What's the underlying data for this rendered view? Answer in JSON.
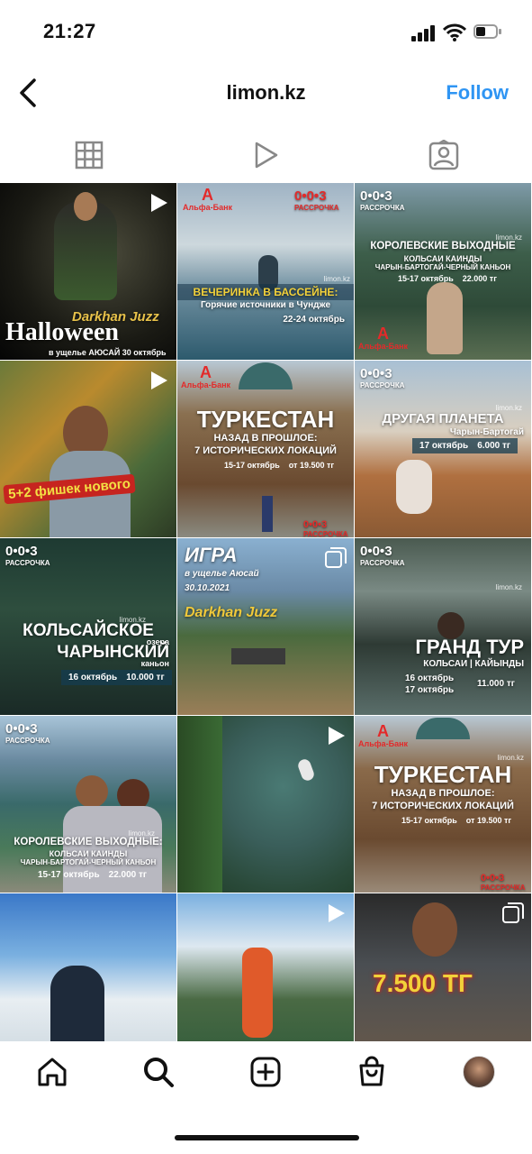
{
  "status": {
    "time": "21:27"
  },
  "header": {
    "username": "limon.kz",
    "follow_label": "Follow"
  },
  "tabs": [
    "grid-icon",
    "reels-icon",
    "tagged-icon"
  ],
  "posts": [
    {
      "big": "Halloween",
      "script": "Darkhan Juzz",
      "small": "в ущелье АЮСАЙ  30 октябрь"
    },
    {
      "headline": "ВЕЧЕРИНКА В БАССЕЙНЕ:",
      "sub": "Горячие источники в Чундже",
      "date": "22-24 октябрь",
      "brand": "0•0•3",
      "brand_sub": "РАССРОЧКА",
      "bank": "Альфа-Банк",
      "site": "limon.kz"
    },
    {
      "brand": "0•0•3",
      "brand_sub": "РАССРОЧКА",
      "site": "limon.kz",
      "headline": "КОРОЛЕВСКИЕ ВЫХОДНЫЕ",
      "l1": "КОЛЬСАИ КАИНДЫ",
      "l2": "ЧАРЫН-БАРТОГАЙ-ЧЕРНЫЙ КАНЬОН",
      "d1": "15-17 октябрь",
      "d2": "22.000 тг",
      "bank": "Альфа-Банк"
    },
    {
      "banner": "5+2 фишек нового"
    },
    {
      "bank": "Альфа-Банк",
      "title": "ТУРКЕСТАН",
      "l1": "НАЗАД В ПРОШЛОЕ:",
      "l2": "7 ИСТОРИЧЕСКИХ ЛОКАЦИЙ",
      "d1": "15-17 октябрь",
      "d2": "от 19.500 тг",
      "brand": "0•0•3",
      "brand_sub": "РАССРОЧКА"
    },
    {
      "brand": "0•0•3",
      "brand_sub": "РАССРОЧКА",
      "site": "limon.kz",
      "title": "ДРУГАЯ ПЛАНЕТА",
      "l1": "Чарын-Бартогай",
      "d1": "17 октябрь",
      "d2": "6.000 тг"
    },
    {
      "brand": "0•0•3",
      "brand_sub": "РАССРОЧКА",
      "site": "limon.kz",
      "small": "озера",
      "title1": "КОЛЬСАЙСКОЕ",
      "title2": "ЧАРЫНСКИЙ",
      "small2": "каньон",
      "d1": "16 октябрь",
      "d2": "10.000 тг"
    },
    {
      "t1": "ИГРА",
      "t2": "в ущелье Аюсай",
      "t3": "30.10.2021",
      "t4": "Darkhan Juzz"
    },
    {
      "brand": "0•0•3",
      "brand_sub": "РАССРОЧКА",
      "site": "limon.kz",
      "title": "ГРАНД ТУР",
      "l1": "КОЛЬСАИ | КАЙЫНДЫ",
      "d1": "16 октябрь",
      "d1b": "17 октябрь",
      "d2": "11.000 тг"
    },
    {
      "brand": "0•0•3",
      "brand_sub": "РАССРОЧКА",
      "site": "limon.kz",
      "headline": "КОРОЛЕВСКИЕ ВЫХОДНЫЕ:",
      "l1": "КОЛЬСАИ КАИНДЫ",
      "l2": "ЧАРЫН-БАРТОГАЙ-ЧЕРНЫЙ КАНЬОН",
      "d1": "15-17 октябрь",
      "d2": "22.000 тг"
    },
    {},
    {
      "bank": "Альфа-Банк",
      "site": "limon.kz",
      "title": "ТУРКЕСТАН",
      "l1": "НАЗАД В ПРОШЛОЕ:",
      "l2": "7 ИСТОРИЧЕСКИХ ЛОКАЦИЙ",
      "d1": "15-17 октябрь",
      "d2": "от 19.500 тг",
      "brand": "0•0•3",
      "brand_sub": "РАССРОЧКА"
    },
    {},
    {},
    {
      "price": "7.500 ТГ"
    }
  ],
  "nav": [
    "home-icon",
    "search-icon",
    "create-icon",
    "shop-icon",
    "profile-avatar"
  ],
  "colors": {
    "follow": "#2f95f3",
    "alfa": "#e32a2a",
    "strip": "#143c50"
  }
}
